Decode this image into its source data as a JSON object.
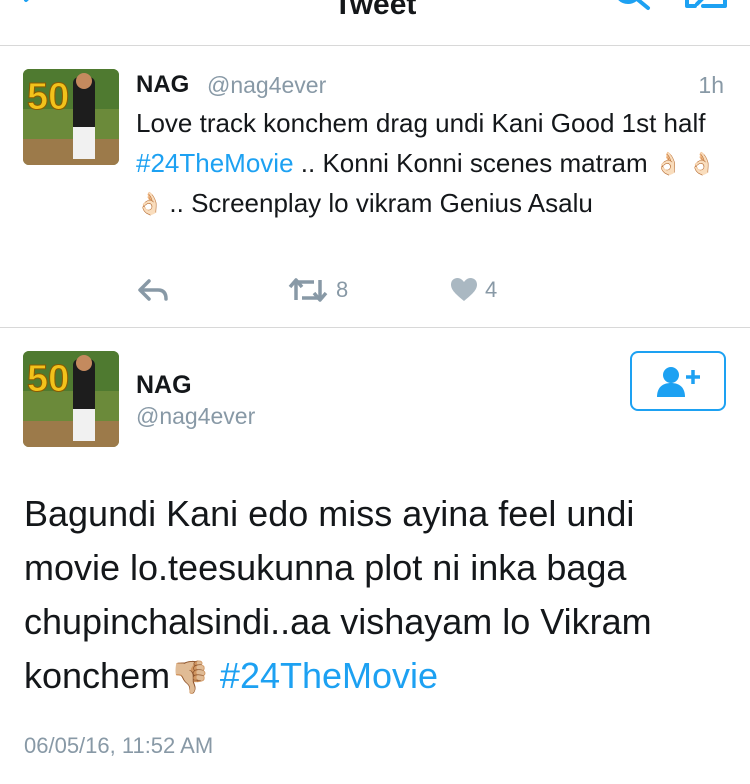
{
  "header": {
    "title": "Tweet",
    "back_icon": "chevron-left-icon",
    "search_icon": "search-icon",
    "compose_icon": "compose-icon",
    "accent": "#1da1f2"
  },
  "reply_tweet": {
    "name": "NAG",
    "handle": "@nag4ever",
    "time": "1h",
    "text_1": "Love track konchem drag undi Kani Good 1st half ",
    "hashtag": "#24TheMovie",
    "text_2": " .. Konni Konni scenes matram ",
    "emojis": [
      "👌🏻",
      "👌🏻",
      "👌🏻"
    ],
    "text_3": ".. Screenplay lo vikram Genius Asalu",
    "actions": {
      "reply_icon": "reply-icon",
      "retweet_icon": "retweet-icon",
      "retweets": "8",
      "like_icon": "heart-icon",
      "likes": "4"
    }
  },
  "main_tweet": {
    "name": "NAG",
    "handle": "@nag4ever",
    "follow_icon": "follow-user-icon",
    "text": "Bagundi Kani edo miss ayina feel undi movie lo.teesukunna plot ni inka baga chupinchalsindi..aa vishayam lo Vikram konchem",
    "emoji": "👎🏼",
    "hashtag": " #24TheMovie",
    "timestamp": "06/05/16, 11:52 AM"
  },
  "colors": {
    "link": "#1da1f2",
    "secondary_text": "#8899a6",
    "divider": "#d8d8d8"
  }
}
